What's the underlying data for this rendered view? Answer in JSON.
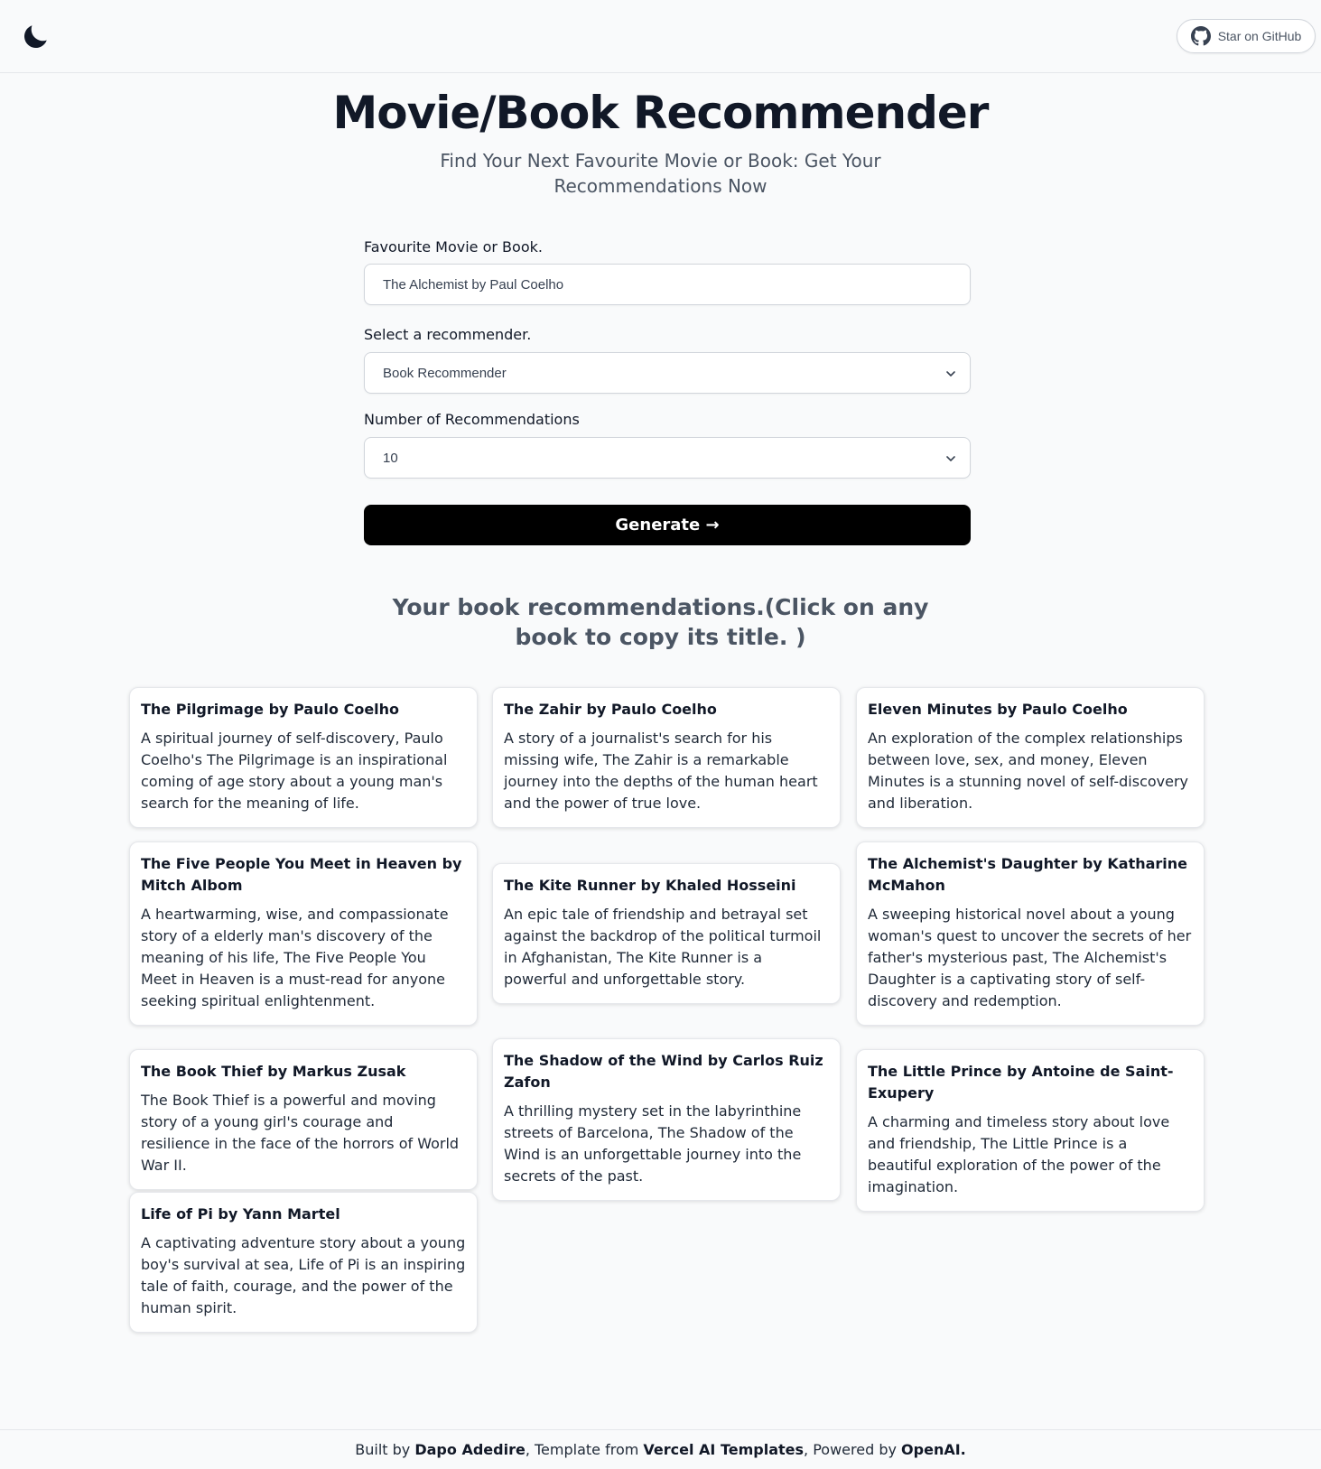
{
  "header": {
    "theme_icon": "moon-icon",
    "github_button": {
      "label": "Star on GitHub",
      "icon": "github-icon"
    }
  },
  "hero": {
    "title": "Movie/Book Recommender",
    "subtitle": "Find Your Next Favourite Movie or Book: Get Your Recommendations Now"
  },
  "form": {
    "favourite": {
      "label": "Favourite Movie or Book.",
      "value": "The Alchemist by Paul Coelho"
    },
    "recommender": {
      "label": "Select a recommender.",
      "value": "Book Recommender"
    },
    "count": {
      "label": "Number of Recommendations",
      "value": "10"
    },
    "generate_label": "Generate →"
  },
  "results": {
    "heading": "Your book recommendations.(Click on any book to copy its title. )",
    "cards": [
      {
        "title": "The Pilgrimage by Paulo Coelho",
        "description": "A spiritual journey of self-discovery, Paulo Coelho's The Pilgrimage is an inspirational coming of age story about a young man's search for the meaning of life."
      },
      {
        "title": "The Zahir by Paulo Coelho",
        "description": "A story of a journalist's search for his missing wife, The Zahir is a remarkable journey into the depths of the human heart and the power of true love."
      },
      {
        "title": "Eleven Minutes by Paulo Coelho",
        "description": "An exploration of the complex relationships between love, sex, and money, Eleven Minutes is a stunning novel of self-discovery and liberation."
      },
      {
        "title": "The Five People You Meet in Heaven by Mitch Albom",
        "description": "A heartwarming, wise, and compassionate story of a elderly man's discovery of the meaning of his life, The Five People You Meet in Heaven is a must-read for anyone seeking spiritual enlightenment."
      },
      {
        "title": "The Kite Runner by Khaled Hosseini",
        "description": "An epic tale of friendship and betrayal set against the backdrop of the political turmoil in Afghanistan, The Kite Runner is a powerful and unforgettable story."
      },
      {
        "title": "The Alchemist's Daughter by Katharine McMahon",
        "description": "A sweeping historical novel about a young woman's quest to uncover the secrets of her father's mysterious past, The Alchemist's Daughter is a captivating story of self-discovery and redemption."
      },
      {
        "title": "The Book Thief by Markus Zusak",
        "description": "The Book Thief is a powerful and moving story of a young girl's courage and resilience in the face of the horrors of World War II."
      },
      {
        "title": "The Shadow of the Wind by Carlos Ruiz Zafon",
        "description": "A thrilling mystery set in the labyrinthine streets of Barcelona, The Shadow of the Wind is an unforgettable journey into the secrets of the past."
      },
      {
        "title": "The Little Prince by Antoine de Saint-Exupery",
        "description": "A charming and timeless story about love and friendship, The Little Prince is a beautiful exploration of the power of the imagination."
      },
      {
        "title": "Life of Pi by Yann Martel",
        "description": "A captivating adventure story about a young boy's survival at sea, Life of Pi is an inspiring tale of faith, courage, and the power of the human spirit."
      }
    ]
  },
  "footer": {
    "built_by": "Built by ",
    "author": "Dapo Adedire",
    "template_from": ", Template from ",
    "template": "Vercel AI Templates",
    "powered_by": ", Powered by ",
    "provider": "OpenAI."
  },
  "colors": {
    "primary_button": "#000000",
    "page_bg": "#f9fafb",
    "title": "#111827"
  }
}
